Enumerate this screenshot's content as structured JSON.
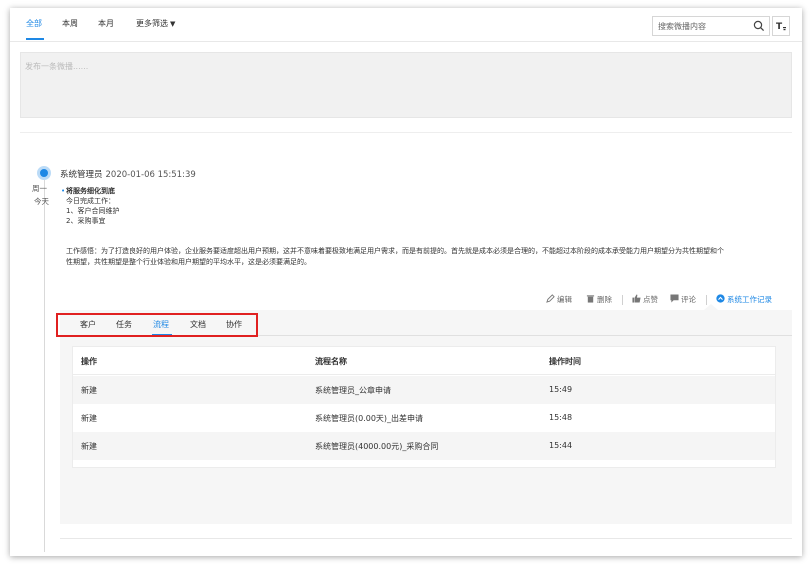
{
  "filter_tabs": [
    {
      "label": "全部",
      "active": true
    },
    {
      "label": "本周",
      "active": false
    },
    {
      "label": "本月",
      "active": false
    },
    {
      "label": "更多筛选",
      "active": false
    }
  ],
  "search": {
    "placeholder": "搜索微播内容",
    "icon": "search-icon"
  },
  "filter_button": {
    "icon": "text-filter-icon",
    "label": "T"
  },
  "compose": {
    "placeholder": "发布一条微播......"
  },
  "timeline": {
    "weekday": "周一",
    "today": "今天"
  },
  "post": {
    "author": "系统管理员",
    "time": "2020-01-06 15:51:39",
    "title": "将服务细化到底",
    "lines": [
      "今日完成工作：",
      "1、客户合同维护",
      "2、采购事宜"
    ],
    "reflection_line1": "工作感悟：为了打造良好的用户体验，企业服务要适度超出用户预期，这并不意味着要极致地满足用户需求，而是有前提的。首先就是成本必须是合理的，不能超过本阶段的成本承受能力用户期望分为共性期望和个",
    "reflection_line2": "性期望，共性期望是整个行业体验和用户期望的平均水平，这是必须要满足的。"
  },
  "actions": {
    "edit": "编辑",
    "delete": "删除",
    "like": "点赞",
    "comment": "评论",
    "work_record": "系统工作记录"
  },
  "panel_tabs": [
    {
      "label": "客户",
      "active": false
    },
    {
      "label": "任务",
      "active": false
    },
    {
      "label": "流程",
      "active": true
    },
    {
      "label": "文档",
      "active": false
    },
    {
      "label": "协作",
      "active": false
    }
  ],
  "table": {
    "headers": [
      "操作",
      "流程名称",
      "操作时间"
    ],
    "rows": [
      [
        "新建",
        "系统管理员_公章申请",
        "15:49"
      ],
      [
        "新建",
        "系统管理员(0.00天)_出差申请",
        "15:48"
      ],
      [
        "新建",
        "系统管理员(4000.00元)_采购合同",
        "15:44"
      ]
    ]
  },
  "colors": {
    "accent": "#1e88e5",
    "highlight_box": "#e02020"
  }
}
